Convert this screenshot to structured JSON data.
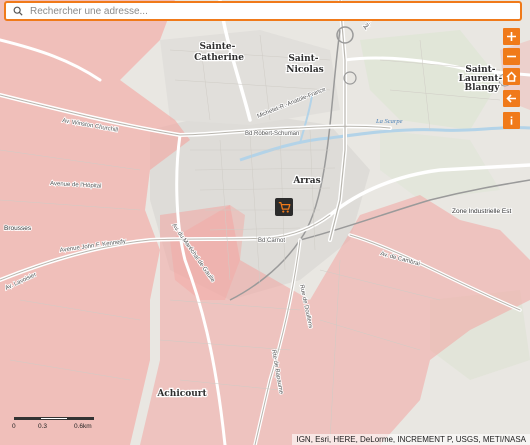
{
  "search": {
    "placeholder": "Rechercher une adresse..."
  },
  "controls": [
    {
      "name": "zoom-in-button",
      "icon": "plus-icon"
    },
    {
      "name": "zoom-out-button",
      "icon": "minus-icon"
    },
    {
      "name": "home-button",
      "icon": "home-icon"
    },
    {
      "name": "back-button",
      "icon": "arrow-left-icon"
    },
    {
      "name": "info-button",
      "icon": "info-icon"
    }
  ],
  "places": {
    "sainte_catherine": [
      "Sainte-",
      "Catherine"
    ],
    "saint_nicolas": [
      "Saint-",
      "Nicolas"
    ],
    "saint_laurent_blangy": [
      "Saint-",
      "Laurent-",
      "Blangy"
    ],
    "arras": "Arras",
    "achicourt": "Achicourt",
    "zone_industrielle": "Zone Industrielle Est",
    "brousses": "Brousses",
    "la_scarpe": "La Scarpe"
  },
  "roads": {
    "bd_robert_schuman": "Bd Robert-Schuman",
    "bd_carnot": "Bd Carnot",
    "av_winston_churchill": "Av. Winston Churchill",
    "av_john_f_kennedy": "Avenue John F. Kennedy",
    "av_hopital": "Avenue de l'Hôpital",
    "av_lavoisier": "Av. Lavoisier",
    "bd_michelet": "Michelet-R.-Anatole-France",
    "rue_gaulle": "Av. du Maréchal de Gaulle",
    "rue_bapaume": "Rte de Bapaume",
    "av_cambrai": "Av. de Cambrai",
    "rue_doullens": "Rue de Doullens",
    "av_lens": "Av. de Lens"
  },
  "scale": {
    "ticks": [
      "0",
      "0.3",
      "0.6km"
    ]
  },
  "attribution": "IGN, Esri, HERE, DeLorme, INCREMENT P, USGS, METI/NASA",
  "colors": {
    "accent": "#f07a1a",
    "zone_fill": "#f3a6a2",
    "base": "#e8e6e1",
    "water": "#b3d3e8"
  }
}
